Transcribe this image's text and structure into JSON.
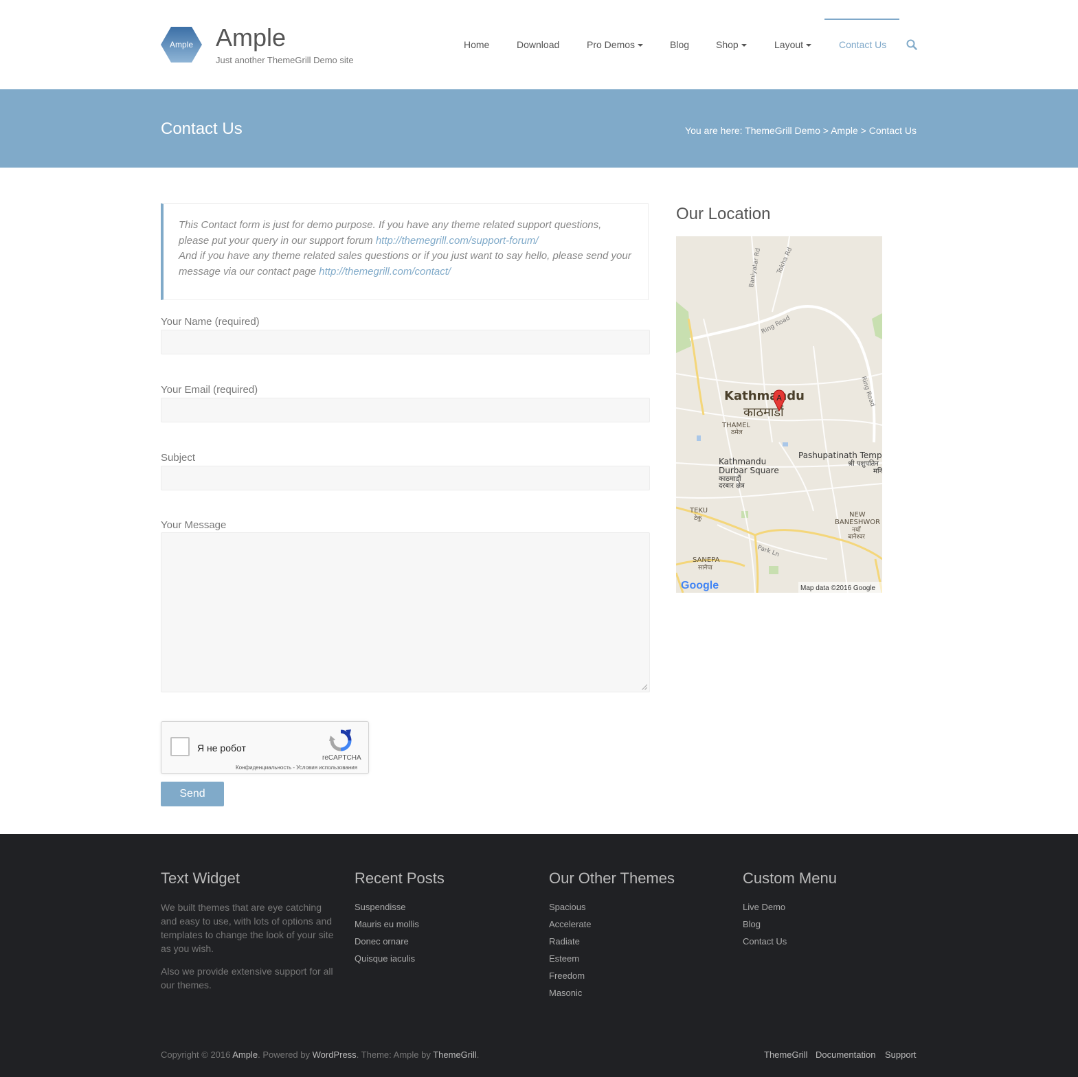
{
  "header": {
    "logo_text": "Ample",
    "site_title": "Ample",
    "site_description": "Just another ThemeGrill Demo site",
    "nav": [
      {
        "label": "Home"
      },
      {
        "label": "Download"
      },
      {
        "label": "Pro Demos"
      },
      {
        "label": "Blog"
      },
      {
        "label": "Shop"
      },
      {
        "label": "Layout"
      },
      {
        "label": "Contact Us"
      }
    ]
  },
  "banner": {
    "title": "Contact Us",
    "breadcrumb_prefix": "You are here: ",
    "crumb_1": "ThemeGrill Demo",
    "sep": " > ",
    "crumb_2": "Ample",
    "crumb_3": "Contact Us"
  },
  "notice": {
    "line1": "This Contact form is just for demo purpose. If you have any theme related support questions, please put your query in our support forum ",
    "link1": "http://themegrill.com/support-forum/",
    "line2": "And if you have any theme related sales questions or if you just want to say hello, please send your message via our contact page ",
    "link2": "http://themegrill.com/contact/"
  },
  "form": {
    "name_label": "Your Name (required)",
    "email_label": "Your Email (required)",
    "subject_label": "Subject",
    "message_label": "Your Message",
    "send_label": "Send"
  },
  "recaptcha": {
    "label": "Я не робот",
    "brand": "reCAPTCHA",
    "terms": "Конфиденциальность - Условия использования"
  },
  "sidebar": {
    "title": "Our Location",
    "map": {
      "city_en": "Kathmandu",
      "city_ne": "काठमाडौं",
      "marker": "A",
      "labels": {
        "thamel": "THAMEL",
        "thamel_ne": "ठमेल",
        "durbar": "Kathmandu",
        "durbar2": "Durbar Square",
        "durbar_ne": "काठमाडौं",
        "durbar_ne2": "दरबार क्षेत्र",
        "pashupati": "Pashupatinath Temp",
        "pashupati_ne": "श्री पशुपतिन",
        "pashupati_ne2": "मनि",
        "teku": "TEKU",
        "teku_ne": "टेकु",
        "baneshwor1": "NEW",
        "baneshwor2": "BANESHWOR",
        "baneshwor_ne1": "नयाँ",
        "baneshwor_ne2": "बानेश्वर",
        "sanepa": "SANEPA",
        "sanepa_ne": "सानेपा",
        "ring_road": "Ring Road",
        "ring_road_2": "Ring Road",
        "park_ln": "Park Ln",
        "baniyatar": "Baniyatar Rd",
        "tokha": "Tokha Rd",
        "google": "Google",
        "map_data": "Map data ©2016 Google"
      }
    }
  },
  "footer": {
    "col1_title": "Text Widget",
    "col1_p1": "We built themes that are eye catching and easy to use, with lots of options and templates to change the look of your site as you wish.",
    "col1_p2": "Also we provide extensive support for all our themes.",
    "col2_title": "Recent Posts",
    "col2_items": [
      "Suspendisse",
      "Mauris eu mollis",
      "Donec ornare",
      "Quisque iaculis"
    ],
    "col3_title": "Our Other Themes",
    "col3_items": [
      "Spacious",
      "Accelerate",
      "Radiate",
      "Esteem",
      "Freedom",
      "Masonic"
    ],
    "col4_title": "Custom Menu",
    "col4_items": [
      "Live Demo",
      "Blog",
      "Contact Us"
    ],
    "copy_1": "Copyright © 2016 ",
    "copy_ample": "Ample",
    "copy_2": ". Powered by ",
    "copy_wp": "WordPress",
    "copy_3": ". Theme: Ample by ",
    "copy_tg": "ThemeGrill",
    "copy_4": ".",
    "bottom_links": [
      "ThemeGrill",
      "Documentation",
      "Support"
    ]
  },
  "colors": {
    "accent": "#80aac9",
    "footer_bg": "#202124",
    "input_bg": "#f7f7f7"
  }
}
